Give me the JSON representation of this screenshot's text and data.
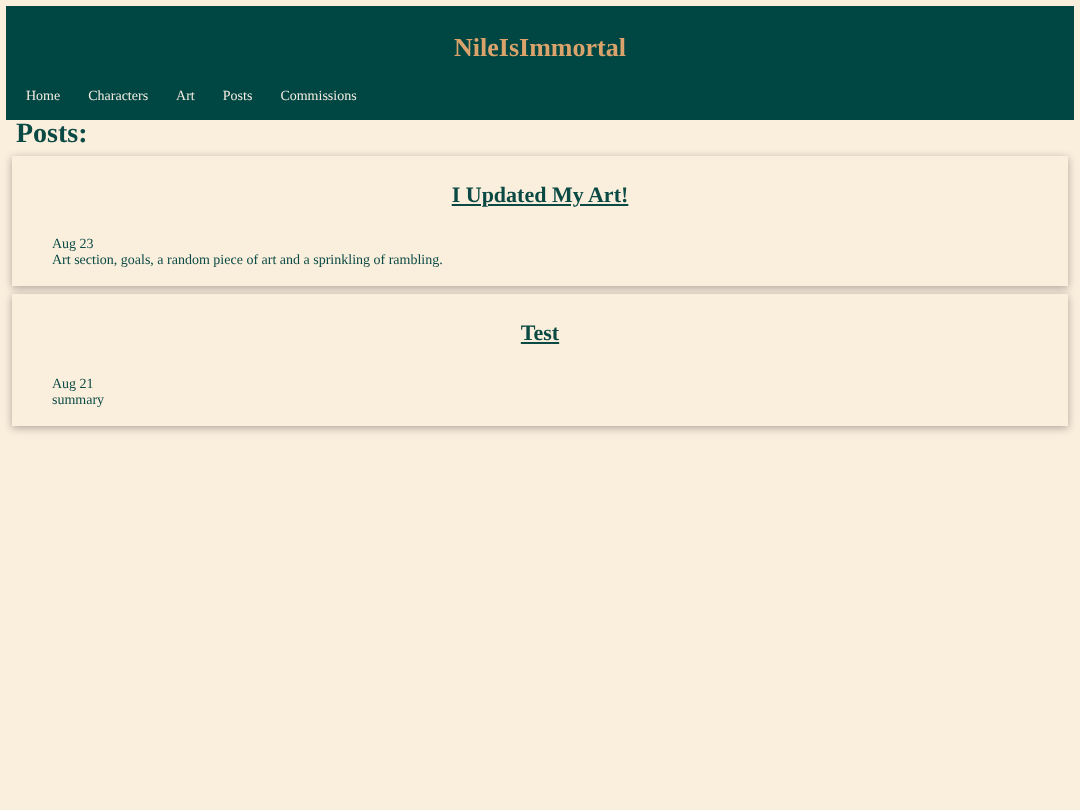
{
  "site": {
    "title": "NileIsImmortal"
  },
  "nav": [
    "Home",
    "Characters",
    "Art",
    "Posts",
    "Commissions"
  ],
  "heading": "Posts:",
  "posts": [
    {
      "title": "I Updated My Art!",
      "date": "Aug 23",
      "summary": "Art section, goals, a random piece of art and a sprinkling of rambling."
    },
    {
      "title": "Test",
      "date": "Aug 21",
      "summary": "summary"
    }
  ]
}
